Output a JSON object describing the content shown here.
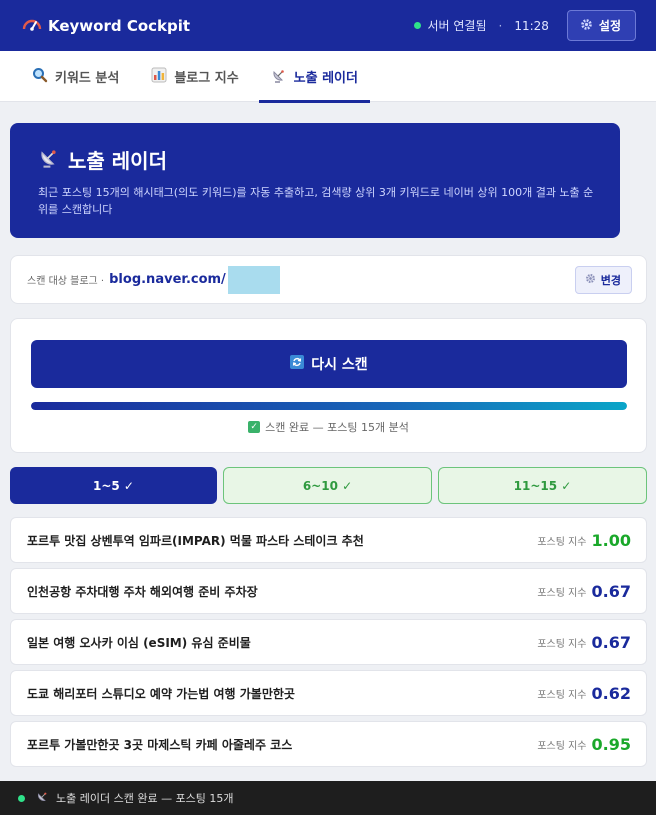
{
  "app": {
    "title": "Keyword Cockpit"
  },
  "header": {
    "status_text": "서버 연결됨",
    "separator": "·",
    "time": "11:28",
    "settings_label": "설정"
  },
  "tabs": [
    {
      "label": "키워드 분석",
      "icon": "magnifier-icon"
    },
    {
      "label": "블로그 지수",
      "icon": "bar-chart-icon"
    },
    {
      "label": "노출 레이더",
      "icon": "satellite-dish-icon",
      "active": true
    }
  ],
  "hero": {
    "title": "노출 레이더",
    "description": "최근 포스팅 15개의 해시태그(의도 키워드)를 자동 추출하고, 검색량 상위 3개 키워드로 네이버 상위 100개 결과 노출 순위를 스캔합니다"
  },
  "blog": {
    "label": "스캔 대상 블로그 ·",
    "url": "blog.naver.com/",
    "change_label": "변경"
  },
  "scan": {
    "button_label": "다시 스캔",
    "progress": 1.0,
    "status_text": "스캔 완료 — 포스팅 15개 분석"
  },
  "range_tabs": [
    {
      "label": "1~5 ✓",
      "active": true
    },
    {
      "label": "6~10 ✓",
      "active": false
    },
    {
      "label": "11~15 ✓",
      "active": false
    }
  ],
  "score_label": "포스팅 지수",
  "keywords": [
    {
      "text": "포르투 맛집 상벤투역 임파르(IMPAR) 먹물 파스타 스테이크 추천",
      "score": "1.00",
      "color": "#1aa82a"
    },
    {
      "text": "인천공항 주차대행 주차 해외여행 준비 주차장",
      "score": "0.67",
      "color": "#1a2a9c"
    },
    {
      "text": "일본 여행 오사카 이심 (eSIM) 유심 준비물",
      "score": "0.67",
      "color": "#1a2a9c"
    },
    {
      "text": "도쿄 해리포터 스튜디오 예약 가는법 여행 가볼만한곳",
      "score": "0.62",
      "color": "#1a2a9c"
    },
    {
      "text": "포르투 가볼만한곳 3곳 마제스틱 카페 아줄레주 코스",
      "score": "0.95",
      "color": "#1aa82a"
    }
  ],
  "footer": {
    "text": "노출 레이더 스캔 완료 — 포스팅 15개"
  },
  "colors": {
    "brand": "#1a2a9c",
    "accent_green": "#1aa82a",
    "status_dot": "#2fe28a"
  }
}
